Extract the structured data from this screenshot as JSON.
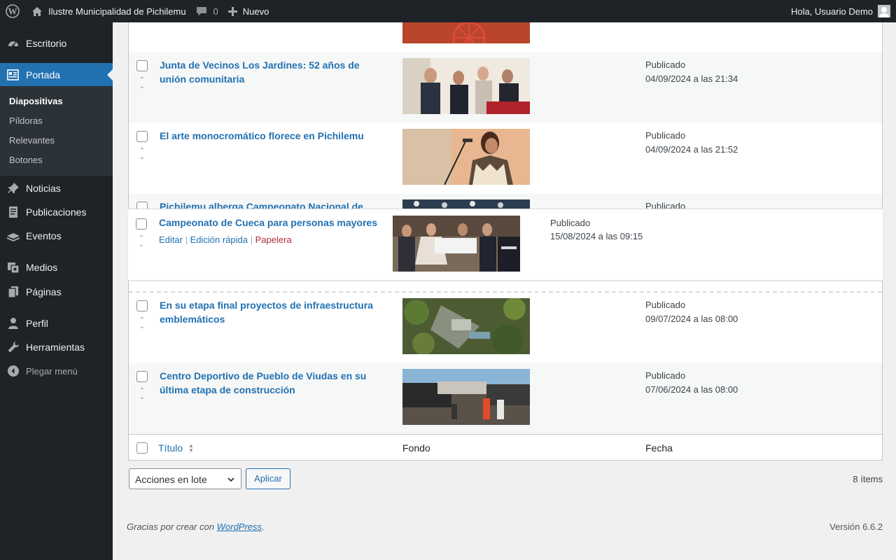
{
  "adminbar": {
    "site_name": "Ilustre Municipalidad de Pichilemu",
    "comments_count": "0",
    "new_label": "Nuevo",
    "greeting": "Hola, Usuario Demo"
  },
  "menu": {
    "escritorio": "Escritorio",
    "portada": "Portada",
    "sub": [
      "Diapositivas",
      "Píldoras",
      "Relevantes",
      "Botones"
    ],
    "noticias": "Noticias",
    "publicaciones": "Publicaciones",
    "eventos": "Eventos",
    "medios": "Medios",
    "paginas": "Páginas",
    "perfil": "Perfil",
    "herramientas": "Herramientas",
    "collapse": "Plegar menú"
  },
  "rows": [
    {
      "title": "Junta de Vecinos Los Jardines: 52 años de unión comunitaria",
      "status": "Publicado",
      "date": "04/09/2024 a las 21:34"
    },
    {
      "title": "El arte monocromático florece en Pichilemu",
      "status": "Publicado",
      "date": "04/09/2024 a las 21:52"
    },
    {
      "title": "Pichilemu alberga Campeonato Nacional de",
      "status": "Publicado",
      "date": ""
    },
    {
      "title": "Campeonato de Cueca para personas mayores",
      "status": "Publicado",
      "date": "15/08/2024 a las 09:15"
    },
    {
      "title": "En su etapa final proyectos de infraestructura emblemáticos",
      "status": "Publicado",
      "date": "09/07/2024 a las 08:00"
    },
    {
      "title": "Centro Deportivo de Pueblo de Viudas en su última etapa de construcción",
      "status": "Publicado",
      "date": "07/06/2024 a las 08:00"
    }
  ],
  "row_actions": {
    "edit": "Editar",
    "quick_edit": "Edición rápida",
    "trash": "Papelera",
    "separator": "|"
  },
  "table_footer": {
    "title": "Título",
    "background": "Fondo",
    "date": "Fecha"
  },
  "bulk": {
    "select_value": "Acciones en lote",
    "apply": "Aplicar",
    "count": "8 ítems"
  },
  "footer": {
    "credit_prefix": "Gracias por crear con",
    "credit_link": "WordPress",
    "credit_suffix": ".",
    "version": "Versión 6.6.2"
  }
}
